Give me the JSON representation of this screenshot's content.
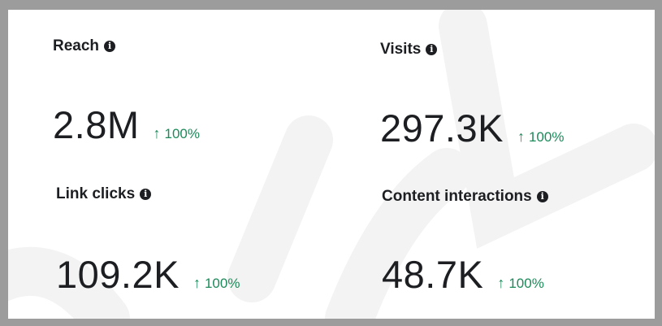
{
  "colors": {
    "positive": "#1d8a5a",
    "text": "#1c1e21",
    "frame": "#9c9c9c"
  },
  "icons": {
    "info": "info-circle-icon",
    "trend": "arrow-up-icon"
  },
  "metrics": [
    {
      "title": "Reach",
      "value": "2.8M",
      "change": "100%",
      "info_glyph": "i",
      "arrow": "↑"
    },
    {
      "title": "Visits",
      "value": "297.3K",
      "change": "100%",
      "info_glyph": "i",
      "arrow": "↑"
    },
    {
      "title": "Link clicks",
      "value": "109.2K",
      "change": "100%",
      "info_glyph": "i",
      "arrow": "↑"
    },
    {
      "title": "Content interactions",
      "value": "48.7K",
      "change": "100%",
      "info_glyph": "i",
      "arrow": "↑"
    }
  ]
}
